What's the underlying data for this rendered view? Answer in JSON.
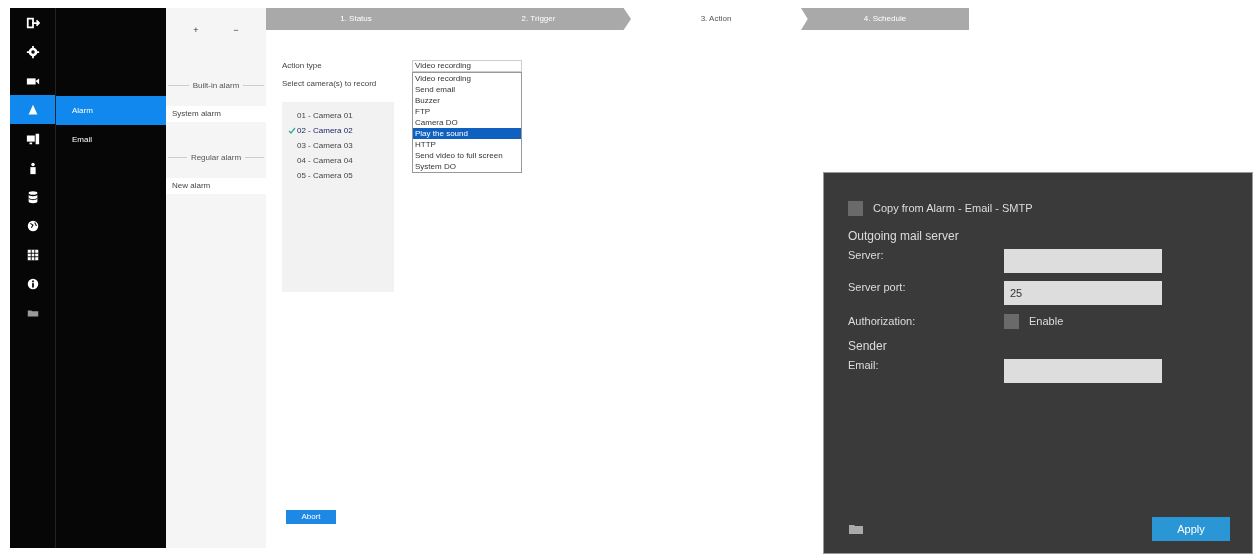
{
  "nav_icons": [
    {
      "kind": "logout",
      "selected": false
    },
    {
      "kind": "gear",
      "selected": false
    },
    {
      "kind": "camera",
      "selected": false
    },
    {
      "kind": "bell",
      "selected": true
    },
    {
      "kind": "monitor",
      "selected": false
    },
    {
      "kind": "person",
      "selected": false
    },
    {
      "kind": "database",
      "selected": false
    },
    {
      "kind": "globe",
      "selected": false
    },
    {
      "kind": "grid",
      "selected": false
    },
    {
      "kind": "info",
      "selected": false
    },
    {
      "kind": "folder",
      "selected": false
    }
  ],
  "sidebar": {
    "items": [
      {
        "label": "Alarm",
        "selected": true
      },
      {
        "label": "Email",
        "selected": false
      }
    ]
  },
  "alarm_panel": {
    "add": "+",
    "remove": "−",
    "sections": [
      {
        "heading": "Built-in alarm",
        "items": [
          "System alarm"
        ]
      },
      {
        "heading": "Regular alarm",
        "items": [
          "New alarm"
        ]
      }
    ]
  },
  "steps": [
    {
      "label": "1. Status",
      "selected": false
    },
    {
      "label": "2. Trigger",
      "selected": false
    },
    {
      "label": "3. Action",
      "selected": true
    },
    {
      "label": "4. Schedule",
      "selected": false
    }
  ],
  "action_type_label": "Action type",
  "cameras_label": "Select camera(s) to record",
  "cameras": [
    {
      "label": "01 - Camera 01",
      "checked": false
    },
    {
      "label": "02 - Camera 02",
      "checked": true
    },
    {
      "label": "03 - Camera 03",
      "checked": false
    },
    {
      "label": "04 - Camera 04",
      "checked": false
    },
    {
      "label": "05 - Camera 05",
      "checked": false
    }
  ],
  "action_select": {
    "value": "Video recording",
    "options": [
      {
        "label": "Video recording",
        "highlighted": false
      },
      {
        "label": "Send email",
        "highlighted": false
      },
      {
        "label": "Buzzer",
        "highlighted": false
      },
      {
        "label": "FTP",
        "highlighted": false
      },
      {
        "label": "Camera DO",
        "highlighted": false
      },
      {
        "label": "Play the sound",
        "highlighted": true
      },
      {
        "label": "HTTP",
        "highlighted": false
      },
      {
        "label": "Send video to full screen",
        "highlighted": false
      },
      {
        "label": "System DO",
        "highlighted": false
      }
    ]
  },
  "abort_button": "Abort",
  "smtp_panel": {
    "copy": {
      "label": "Copy from Alarm - Email - SMTP",
      "checked": false
    },
    "heading": "Outgoing mail server",
    "server_label": "Server:",
    "port_label": "Server port:",
    "port_value": "25",
    "auth_label": "Authorization:",
    "auth": {
      "label": "Enable",
      "checked": false
    },
    "sender_heading": "Sender",
    "email_label": "Email:",
    "apply": "Apply"
  }
}
